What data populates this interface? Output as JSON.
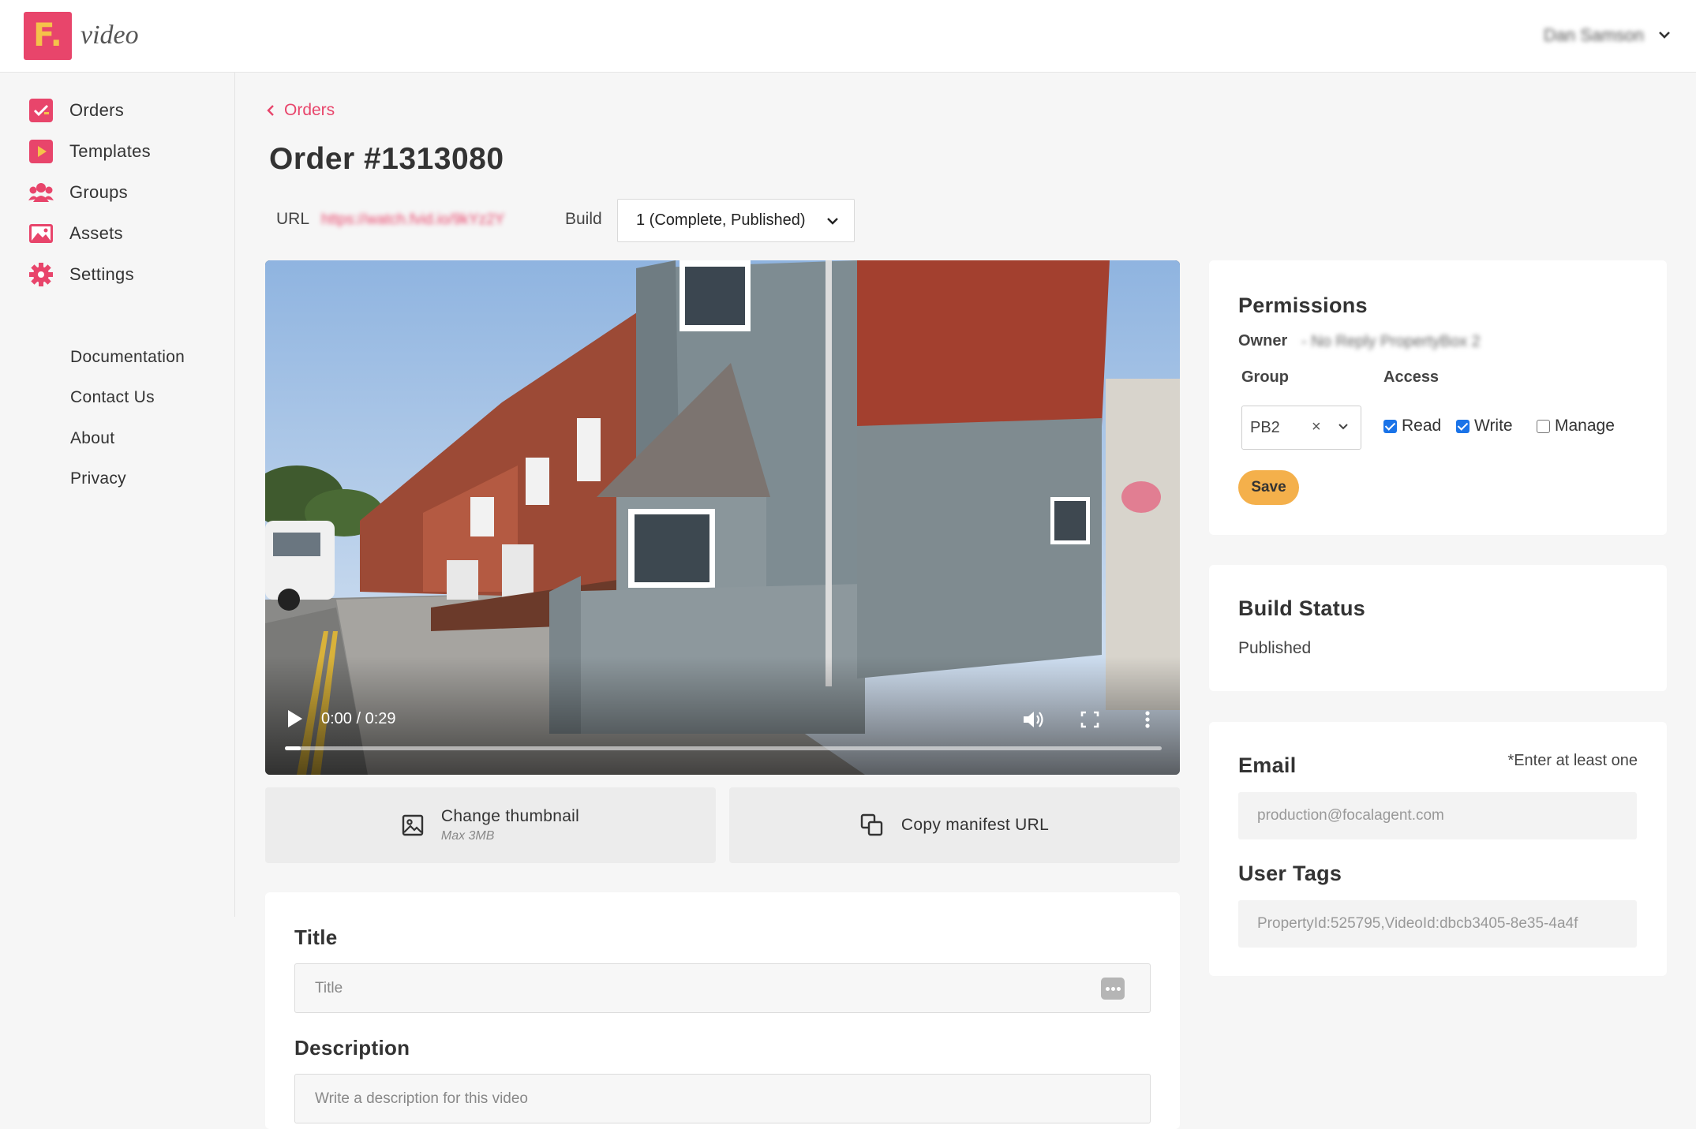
{
  "header": {
    "logo_letter": "F.",
    "logo_text": "video",
    "user_name": "Dan Samson"
  },
  "sidebar": {
    "nav": [
      {
        "label": "Orders",
        "icon": "orders-icon"
      },
      {
        "label": "Templates",
        "icon": "templates-icon"
      },
      {
        "label": "Groups",
        "icon": "groups-icon"
      },
      {
        "label": "Assets",
        "icon": "assets-icon"
      },
      {
        "label": "Settings",
        "icon": "settings-icon"
      }
    ],
    "links": [
      "Documentation",
      "Contact Us",
      "About",
      "Privacy"
    ]
  },
  "main": {
    "breadcrumb": "Orders",
    "title": "Order #1313080",
    "url_label": "URL",
    "url_value": "https://watch.fvid.io/9kYz2Y",
    "build_label": "Build",
    "build_value": "1 (Complete, Published)",
    "video": {
      "time": "0:00 / 0:29",
      "progress": 0.0
    },
    "change_thumbnail": {
      "label": "Change thumbnail",
      "sub": "Max 3MB"
    },
    "copy_manifest": {
      "label": "Copy manifest URL"
    },
    "title_heading": "Title",
    "title_placeholder": "Title",
    "description_heading": "Description",
    "description_placeholder": "Write a description for this video"
  },
  "permissions": {
    "title": "Permissions",
    "owner_label": "Owner",
    "owner_value": "- No Reply PropertyBox 2",
    "group_heading": "Group",
    "access_heading": "Access",
    "group_value": "PB2",
    "clear": "×",
    "read": "Read",
    "write": "Write",
    "manage": "Manage",
    "save": "Save"
  },
  "build_status": {
    "title": "Build Status",
    "value": "Published"
  },
  "contact": {
    "email_heading": "Email",
    "hint": "*Enter at least one",
    "email_placeholder": "production@focalagent.com",
    "tags_heading": "User Tags",
    "tags_placeholder": "PropertyId:525795,VideoId:dbcb3405-8e35-4a4f"
  },
  "colors": {
    "accent": "#e8456b",
    "save": "#f4b04b",
    "checkbox": "#1a73e8"
  }
}
